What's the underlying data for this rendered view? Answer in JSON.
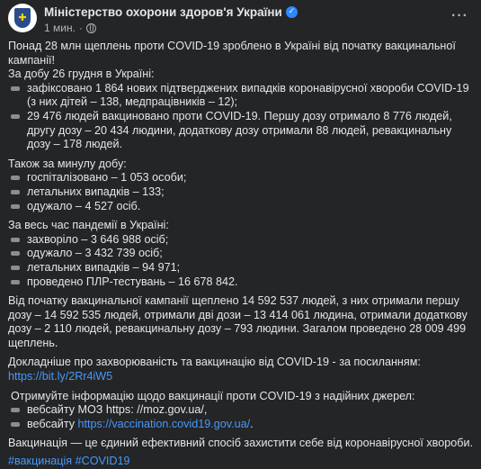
{
  "header": {
    "page_name": "Міністерство охорони здоров'я України",
    "time": "1 мин.",
    "dot": "·",
    "more": "···"
  },
  "post": {
    "intro": "Понад 28 млн щеплень проти COVID-19 зроблено в Україні від початку вакцинальної кампанії!",
    "day_title": "За добу 26 грудня в Україні:",
    "day_items": [
      "зафіксовано 1 864 нових підтверджених випадків коронавірусної хвороби COVID-19 (з них дітей – 138, медпрацівників – 12);",
      "29 476 людей вакциновано проти COVID-19. Першу дозу отримало 8 776 людей, другу дозу – 20 434 людини, додаткову дозу отримали 88 людей, ревакцинальну дозу – 178 людей."
    ],
    "yesterday_title": "Також за минулу добу:",
    "yesterday_items": [
      "госпіталізовано – 1 053 особи;",
      "летальних випадків – 133;",
      "одужало – 4 527 осіб."
    ],
    "total_title": "За весь час пандемії в Україні:",
    "total_items": [
      "захворіло – 3 646 988 осіб;",
      "одужало – 3 432 739 осіб;",
      "летальних випадків – 94 971;",
      "проведено ПЛР-тестувань – 16 678 842."
    ],
    "campaign": "Від початку вакцинальної кампанії щеплено 14 592 537 людей, з них отримали першу дозу – 14 592 535 людей, отримали дві дози – 13 414 061 людина, отримали додаткову дозу – 2 110 людей, ревакцинальну дозу – 793 людини. Загалом проведено 28 009 499  щеплень.",
    "more_info": "Докладніше про захворюваність та вакцинацію від COVID-19 - за посиланням:",
    "more_info_link": "https://bit.ly/2Rr4iW5",
    "sources_title": "Отримуйте інформацію щодо вакцинації проти COVID-19 з надійних джерел:",
    "source1": "вебсайту МОЗ https: //moz.gov.ua/,",
    "source2_prefix": "вебсайту ",
    "source2_link": "https://vaccination.covid19.gov.ua/",
    "source2_suffix": ".",
    "closing": "Вакцинація — це єдиний ефективний спосіб захистити себе від коронавірусної хвороби.",
    "hashtags": "#вакцинація #COVID19"
  },
  "icons": {
    "avatar": "ministry-emblem",
    "verified": "verified-badge-icon",
    "privacy": "globe-icon",
    "bullet": "bullet-icon"
  },
  "colors": {
    "background": "#242526",
    "text": "#e4e6eb",
    "secondary": "#b0b3b8",
    "link": "#4599ff",
    "verified": "#2d88ff"
  }
}
